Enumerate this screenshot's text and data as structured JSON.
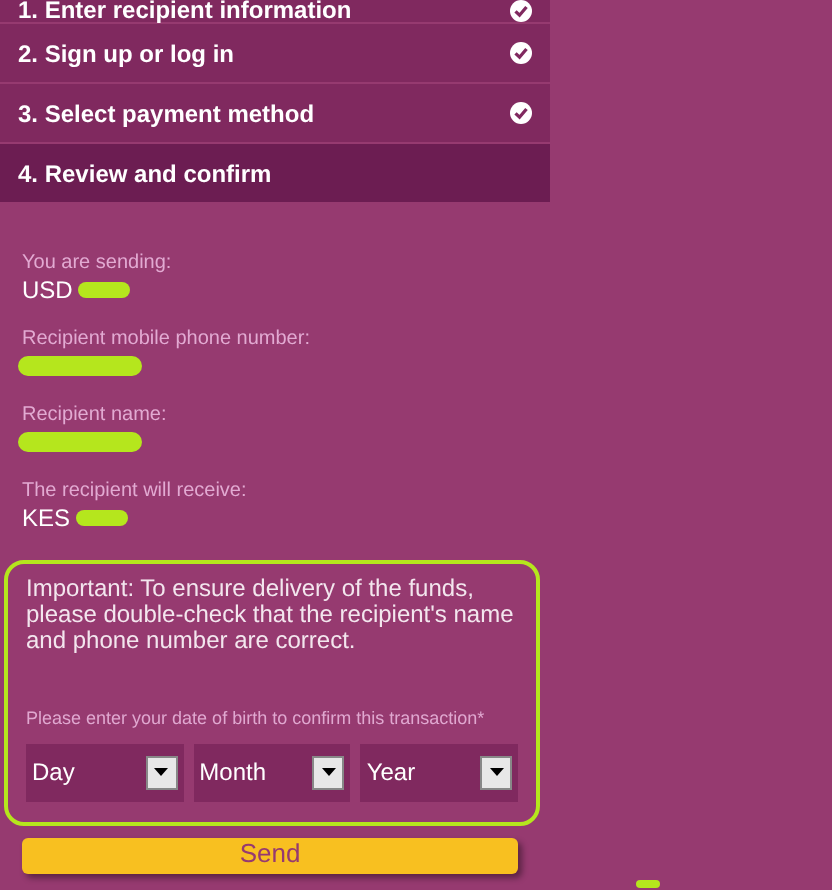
{
  "steps": [
    {
      "label": "1. Enter recipient information",
      "completed": true,
      "selected": false
    },
    {
      "label": "2. Sign up or log in",
      "completed": true,
      "selected": false
    },
    {
      "label": "3. Select payment method",
      "completed": true,
      "selected": false
    },
    {
      "label": "4. Review and confirm",
      "completed": false,
      "selected": true
    }
  ],
  "summary": [
    {
      "label": "You are sending:",
      "value": "USD",
      "redacted": true
    },
    {
      "label": "Recipient mobile phone number:",
      "redacted": true
    },
    {
      "label": "Recipient name:",
      "redacted": true
    },
    {
      "label": "The recipient will receive:",
      "value": "KES",
      "redacted": true
    }
  ],
  "notice": {
    "text": "Important: To ensure delivery of the funds, please double-check that the recipient's name and phone number are correct.",
    "dob_prompt": "Please enter your date of birth to confirm this transaction*",
    "selects": [
      {
        "value": "Day"
      },
      {
        "value": "Month"
      },
      {
        "value": "Year"
      }
    ]
  },
  "send_button": {
    "label": "Send"
  }
}
